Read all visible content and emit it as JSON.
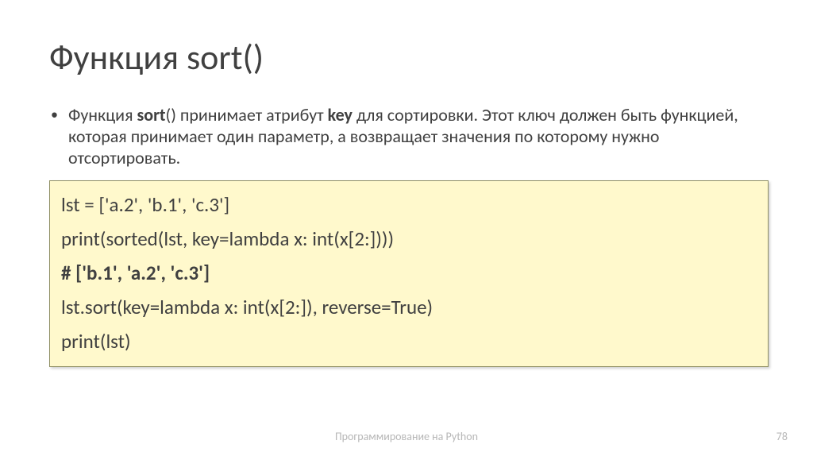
{
  "title": "Функция sort()",
  "bullet": {
    "leading": " Функция ",
    "bold1": "sort",
    "mid1": "() принимает атрибут ",
    "bold2": "key",
    "mid2": " для сортировки. Этот ключ должен быть функцией, которая принимает один параметр, а возвращает значения по которому нужно отсортировать."
  },
  "code": {
    "l1": "lst = ['a.2', 'b.1', 'c.3']",
    "l2": "print(sorted(lst, key=lambda x: int(x[2:])))",
    "l3": "# ['b.1', 'a.2', 'c.3']",
    "l4": "lst.sort(key=lambda x: int(x[2:]), reverse=True)",
    "l5": "print(lst)"
  },
  "footer": {
    "center": "Программирование на Python",
    "page": "78"
  }
}
